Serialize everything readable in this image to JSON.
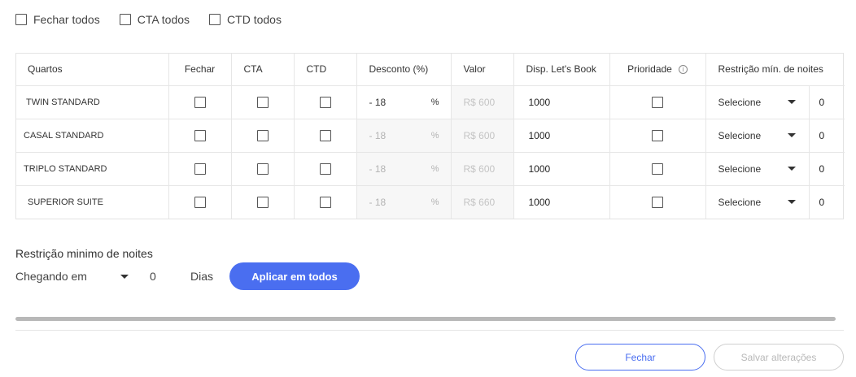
{
  "top_checks": {
    "close_all": "Fechar todos",
    "cta_all": "CTA todos",
    "ctd_all": "CTD todos"
  },
  "table": {
    "headers": {
      "rooms": "Quartos",
      "close": "Fechar",
      "cta": "CTA",
      "ctd": "CTD",
      "discount": "Desconto (%)",
      "value": "Valor",
      "availability": "Disp. Let's Book",
      "priority": "Prioridade",
      "min_nights": "Restrição mín. de noites"
    },
    "rows": [
      {
        "room": "TWIN STANDARD",
        "discount": "- 18",
        "percent": "%",
        "value": "R$ 600",
        "availability": "1000",
        "restriction": "Selecione",
        "nights": "0"
      },
      {
        "room": "CASAL STANDARD",
        "discount": "- 18",
        "percent": "%",
        "value": "R$ 600",
        "availability": "1000",
        "restriction": "Selecione",
        "nights": "0"
      },
      {
        "room": "TRIPLO STANDARD",
        "discount": "- 18",
        "percent": "%",
        "value": "R$ 600",
        "availability": "1000",
        "restriction": "Selecione",
        "nights": "0"
      },
      {
        "room": "SUPERIOR SUITE",
        "discount": "- 18",
        "percent": "%",
        "value": "R$ 660",
        "availability": "1000",
        "restriction": "Selecione",
        "nights": "0"
      }
    ]
  },
  "min_nights_section": {
    "title": "Restrição minimo de noites",
    "arrival_select": "Chegando em",
    "nights_value": "0",
    "days_label": "Dias",
    "apply_button": "Aplicar em todos"
  },
  "footer": {
    "close_button": "Fechar",
    "save_button": "Salvar alterações"
  },
  "colors": {
    "accent": "#4a6ef0",
    "disabled_text": "#b8b8b8"
  },
  "icons": {
    "priority_info": "info-icon",
    "dropdown": "caret-down-icon"
  }
}
